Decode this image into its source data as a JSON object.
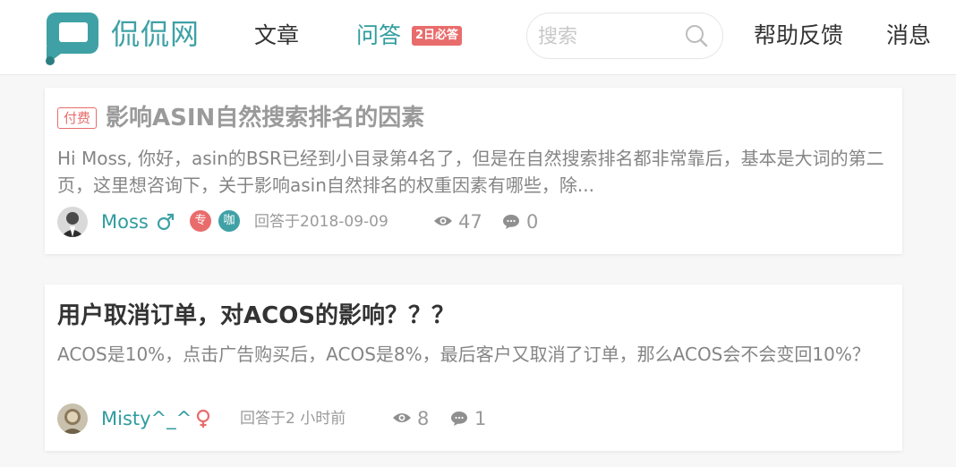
{
  "header": {
    "logo_text": "侃侃网",
    "nav": {
      "articles": "文章",
      "qa": "问答",
      "qa_badge": "2日必答",
      "help": "帮助反馈",
      "messages": "消息"
    },
    "search": {
      "placeholder": "搜索",
      "value": ""
    }
  },
  "colors": {
    "brand": "#3fa1a5",
    "accent_red": "#e96c6c",
    "meta_gray": "#9a9a9a"
  },
  "questions": [
    {
      "paid_tag": "付费",
      "title": "影响ASIN自然搜索排名的因素",
      "description": "Hi Moss, 你好，asin的BSR已经到小目录第4名了，但是在自然搜索排名都非常靠后，基本是大词的第二页，这里想咨询下，关于影响asin自然排名的权重因素有哪些，除...",
      "author": "Moss",
      "gender": "male",
      "gender_symbol": "♂",
      "badges": [
        {
          "text": "专",
          "color": "#e96c6c"
        },
        {
          "text": "咖",
          "color": "#3fa1a5"
        }
      ],
      "answered": "回答于2018-09-09",
      "views": "47",
      "comments": "0"
    },
    {
      "title": "用户取消订单，对ACOS的影响？？？",
      "description": "ACOS是10%，点击广告购买后，ACOS是8%，最后客户又取消了订单，那么ACOS会不会变回10%？",
      "author": "Misty^_^",
      "gender": "female",
      "gender_symbol": "♀",
      "answered": "回答于2 小时前",
      "views": "8",
      "comments": "1"
    }
  ]
}
